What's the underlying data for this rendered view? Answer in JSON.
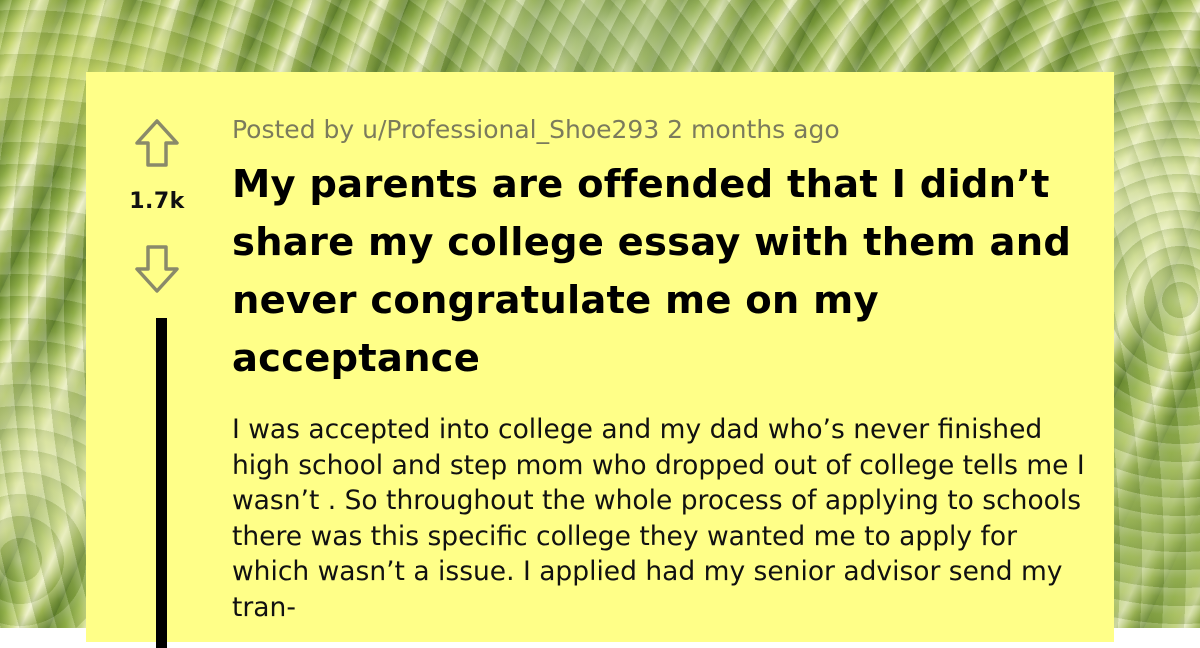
{
  "post": {
    "meta": "Posted by u/Professional_Shoe293 2 months ago",
    "score": "1.7k",
    "title": "My parents are offended that I didn’t share my college essay with them and never congratulate me on my acceptance",
    "body": "I was accepted into college and my dad who’s never finished high school and step mom who dropped out of college tells me I wasn’t . So throughout the whole process of applying to schools there was this specific college they wanted me to apply for which wasn’t a issue. I applied had my senior advisor send my tran-"
  },
  "icons": {
    "upvote": "upvote-arrow-icon",
    "downvote": "downvote-arrow-icon"
  },
  "colors": {
    "card_background": "#ffff88",
    "meta_text": "#7b7b5c",
    "title_text": "#000000",
    "thread_line": "#000000"
  }
}
